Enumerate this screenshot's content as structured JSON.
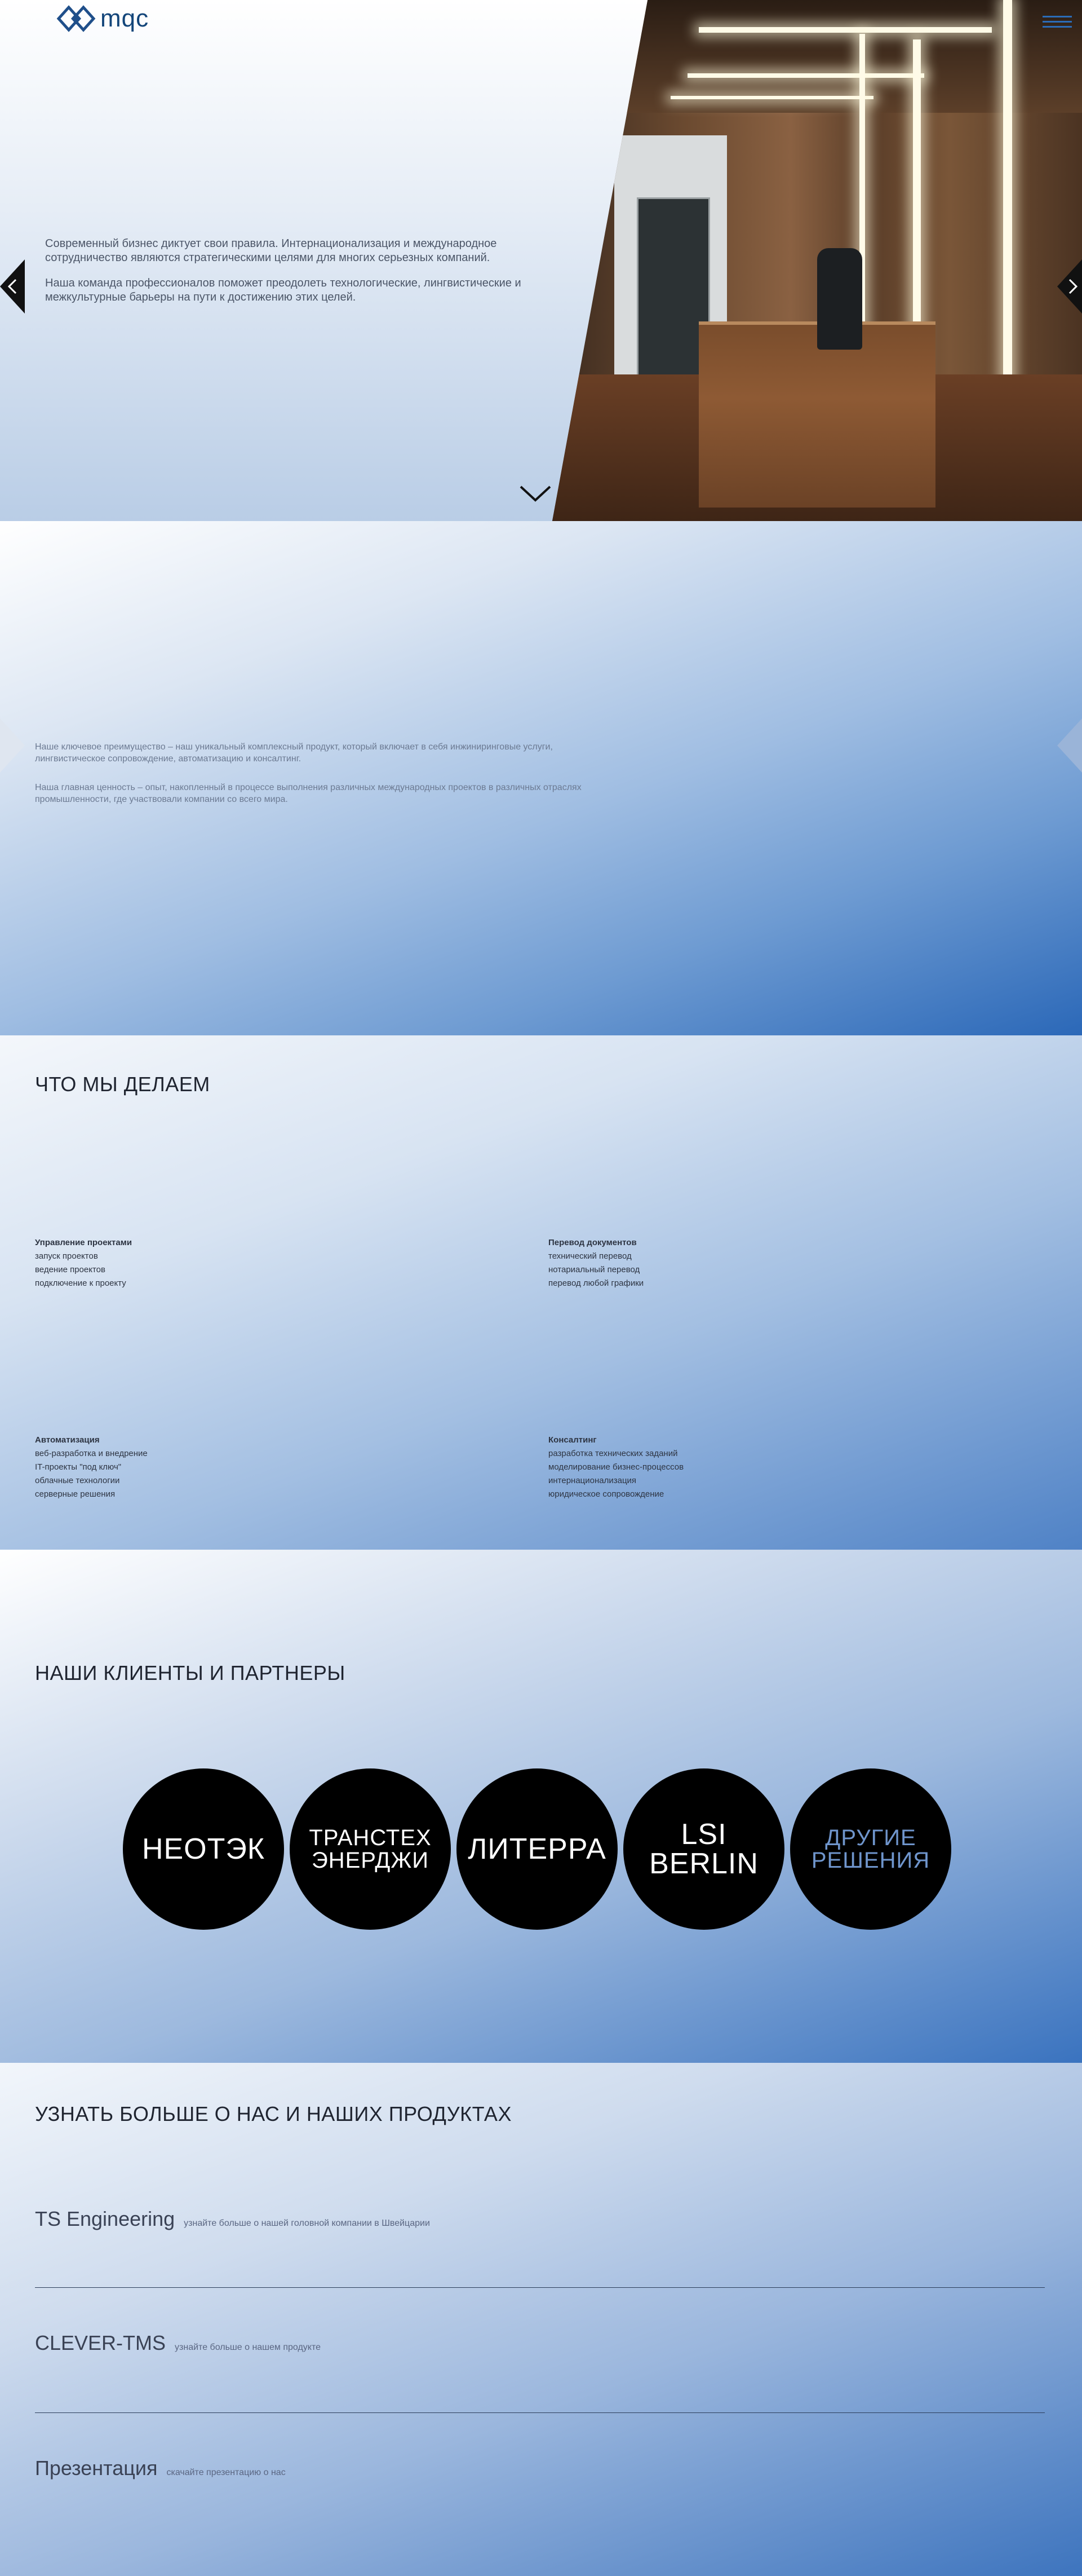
{
  "header": {
    "logo_text": "mqc",
    "logo_icon": "diamond-logo-icon",
    "menu_icon": "hamburger-menu-icon"
  },
  "hero": {
    "paragraph_1": "Современный бизнес диктует свои правила. Интернационализация и международное сотрудничество являются стратегическими целями для многих серьезных компаний.",
    "paragraph_2": "Наша команда профессионалов поможет преодолеть технологические, лингвистические и межкультурные барьеры на пути к достижению этих целей.",
    "prev_icon": "chevron-left-icon",
    "next_icon": "chevron-right-icon",
    "scroll_icon": "chevron-down-icon"
  },
  "about": {
    "paragraph_1": "Наше ключевое преимущество – наш уникальный комплексный продукт, который включает в себя инжиниринговые услуги, лингвистическое сопровождение, автоматизацию и консалтинг.",
    "paragraph_2": "Наша главная ценность – опыт, накопленный в процессе выполнения различных международных проектов в различных отраслях промышленности, где участвовали компании со всего мира."
  },
  "services": {
    "title": "ЧТО МЫ ДЕЛАЕМ",
    "groups": [
      {
        "title": "Управление проектами",
        "items": [
          "запуск проектов",
          "ведение проектов",
          "подключение к проекту"
        ]
      },
      {
        "title": "Перевод документов",
        "items": [
          "технический перевод",
          "нотариальный перевод",
          "перевод любой графики"
        ]
      },
      {
        "title": "Автоматизация",
        "items": [
          "веб-разработка и внедрение",
          "IT-проекты \"под ключ\"",
          "облачные технологии",
          "серверные решения"
        ]
      },
      {
        "title": "Консалтинг",
        "items": [
          "разработка технических заданий",
          "моделирование бизнес-процессов",
          "интернационализация",
          "юридическое сопровождение"
        ]
      }
    ]
  },
  "clients": {
    "title": "НАШИ КЛИЕНТЫ И ПАРТНЕРЫ",
    "items": [
      {
        "line1": "НЕОТЭК",
        "line2": ""
      },
      {
        "line1": "ТРАНСТЕХ",
        "line2": "ЭНЕРДЖИ"
      },
      {
        "line1": "ЛИТЕРРА",
        "line2": ""
      },
      {
        "line1": "LSI BERLIN",
        "line2": ""
      },
      {
        "line1": "ДРУГИЕ",
        "line2": "РЕШЕНИЯ"
      }
    ]
  },
  "more": {
    "title": "УЗНАТЬ БОЛЬШЕ О НАС И НАШИХ ПРОДУКТАХ",
    "links": [
      {
        "name": "TS Engineering",
        "desc": "узнайте больше о нашей головной компании в Швейцарии"
      },
      {
        "name": "CLEVER-TMS",
        "desc": "узнайте больше о нашем продукте"
      },
      {
        "name": "Презентация",
        "desc": "скачайте презентацию о нас"
      }
    ]
  }
}
